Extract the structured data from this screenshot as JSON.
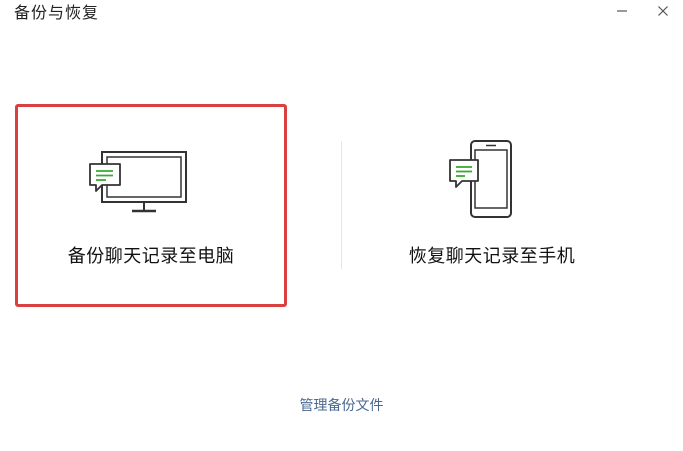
{
  "window": {
    "title": "备份与恢复",
    "minimize_icon": "minimize-icon",
    "close_icon": "close-icon"
  },
  "options": {
    "backup": {
      "label": "备份聊天记录至电脑",
      "icon": "monitor-with-chat-icon",
      "selected": true,
      "border_color": "#d94141"
    },
    "restore": {
      "label": "恢复聊天记录至手机",
      "icon": "phone-with-chat-icon",
      "selected": false
    }
  },
  "footer": {
    "manage_link": "管理备份文件",
    "link_color": "#4a6890"
  },
  "colors": {
    "accent_green": "#3aaa35",
    "icon_stroke": "#333333"
  }
}
